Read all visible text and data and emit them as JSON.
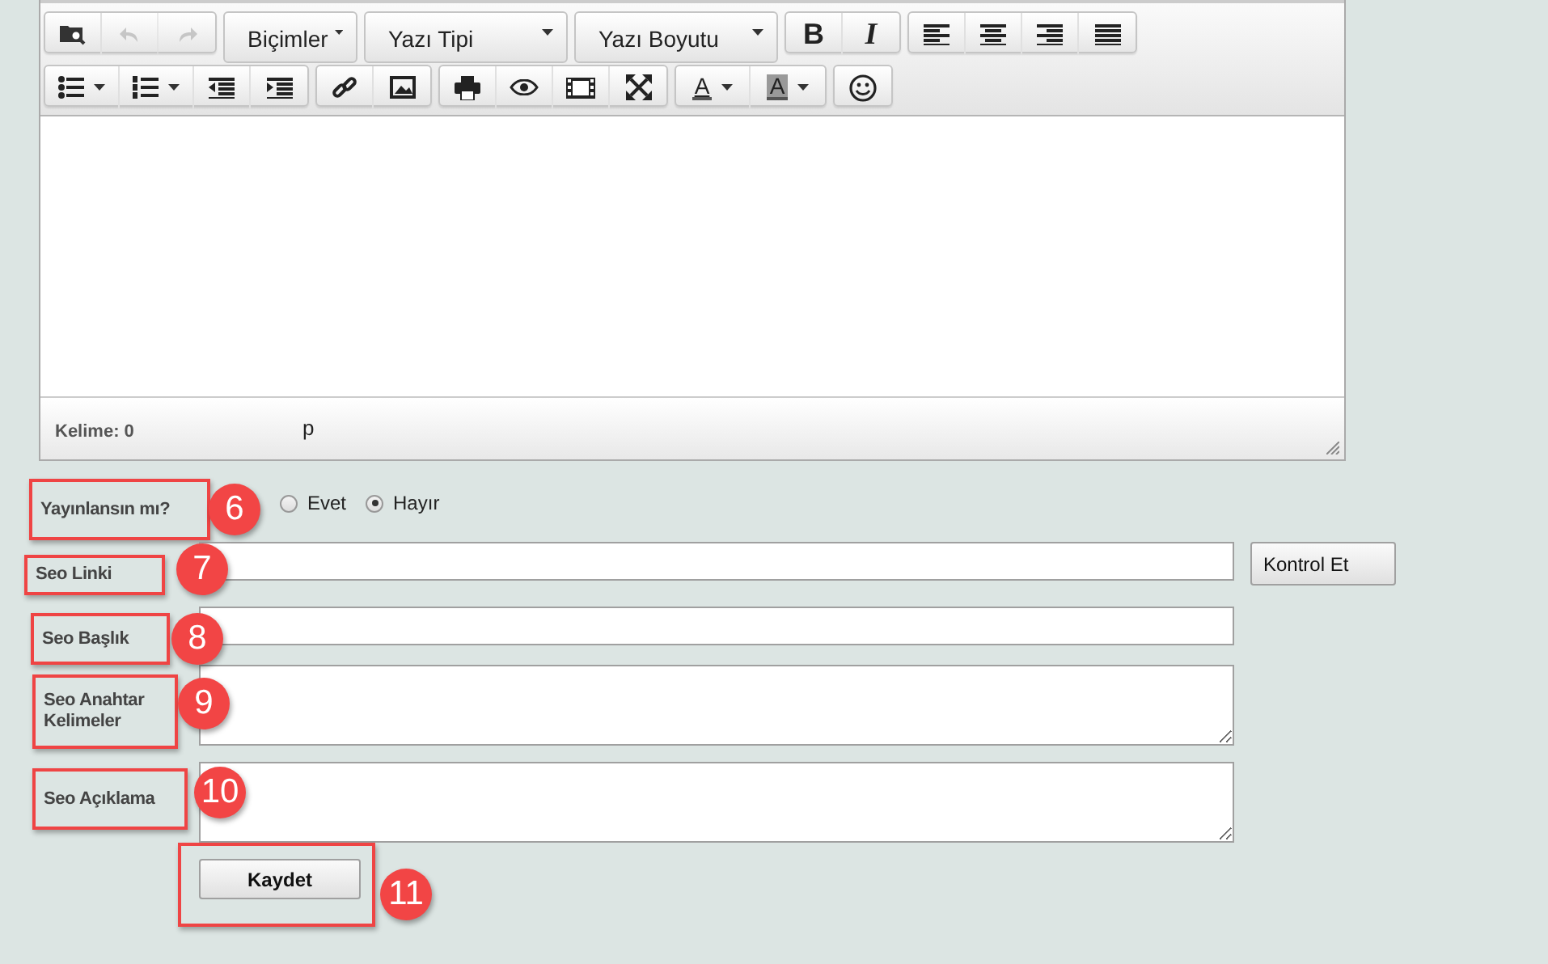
{
  "editor": {
    "toolbar_rows": [
      [
        {
          "kind": "group",
          "buttons": [
            {
              "kind": "find",
              "disabled": false,
              "dropdown": false
            },
            {
              "kind": "undo",
              "disabled": true,
              "dropdown": false
            },
            {
              "kind": "redo",
              "disabled": true,
              "dropdown": false
            }
          ]
        },
        {
          "kind": "menu",
          "label": "Biçimler",
          "wide": false
        },
        {
          "kind": "menu",
          "label": "Yazı Tipi",
          "wide": true
        },
        {
          "kind": "menu",
          "label": "Yazı Boyutu",
          "wide": true
        },
        {
          "kind": "group",
          "buttons": [
            {
              "kind": "bold",
              "label": "B",
              "disabled": false,
              "dropdown": false
            },
            {
              "kind": "italic",
              "label": "I",
              "disabled": false,
              "dropdown": false
            }
          ]
        },
        {
          "kind": "group",
          "buttons": [
            {
              "kind": "alignleft",
              "disabled": false,
              "dropdown": false
            },
            {
              "kind": "aligncenter",
              "disabled": false,
              "dropdown": false
            },
            {
              "kind": "alignright",
              "disabled": false,
              "dropdown": false
            },
            {
              "kind": "justify",
              "disabled": false,
              "dropdown": false
            }
          ]
        }
      ],
      [
        {
          "kind": "group",
          "buttons": [
            {
              "kind": "bullets",
              "disabled": false,
              "dropdown": true
            },
            {
              "kind": "numbers",
              "disabled": false,
              "dropdown": true
            },
            {
              "kind": "outdent",
              "disabled": false,
              "dropdown": false
            },
            {
              "kind": "indent",
              "disabled": false,
              "dropdown": false
            }
          ]
        },
        {
          "kind": "group",
          "buttons": [
            {
              "kind": "link",
              "disabled": false,
              "dropdown": false
            },
            {
              "kind": "image",
              "disabled": false,
              "dropdown": false
            }
          ]
        },
        {
          "kind": "group",
          "buttons": [
            {
              "kind": "print",
              "disabled": false,
              "dropdown": false
            },
            {
              "kind": "preview",
              "disabled": false,
              "dropdown": false
            },
            {
              "kind": "media",
              "disabled": false,
              "dropdown": false
            },
            {
              "kind": "fullscreen",
              "disabled": false,
              "dropdown": false
            }
          ]
        },
        {
          "kind": "group",
          "buttons": [
            {
              "kind": "forecolor",
              "label": "A",
              "disabled": false,
              "dropdown": true
            },
            {
              "kind": "backcolor",
              "label": "A",
              "disabled": false,
              "dropdown": true
            }
          ]
        },
        {
          "kind": "group",
          "buttons": [
            {
              "kind": "emoticons",
              "disabled": false,
              "dropdown": false
            }
          ]
        }
      ]
    ],
    "word_count": "Kelime: 0",
    "path": "p"
  },
  "publish": {
    "label": "Yayınlansın mı?",
    "badge": "6",
    "options": [
      {
        "label": "Evet",
        "selected": false
      },
      {
        "label": "Hayır",
        "selected": true
      }
    ]
  },
  "fields": [
    {
      "label": "Seo Linki",
      "badge": "7",
      "kind": "input",
      "button": "Kontrol Et"
    },
    {
      "label": "Seo Başlık",
      "badge": "8",
      "kind": "input"
    },
    {
      "label": "Seo Anahtar Kelimeler",
      "badge": "9",
      "kind": "textarea"
    },
    {
      "label": "Seo Açıklama",
      "badge": "10",
      "kind": "textarea"
    }
  ],
  "save": {
    "label": "Kaydet",
    "badge": "11"
  }
}
